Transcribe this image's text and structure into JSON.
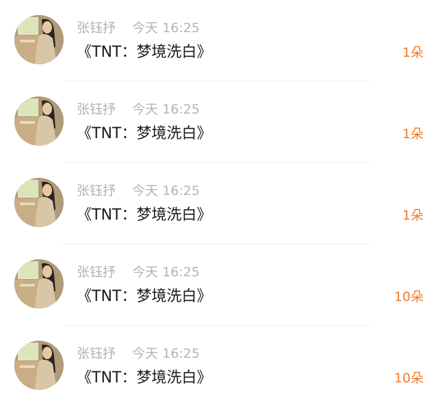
{
  "colors": {
    "name_gray": "#b3b3b3",
    "title_black": "#1a1a1a",
    "count_orange": "#f07a2b"
  },
  "records": [
    {
      "avatar": "user-avatar-photo",
      "name": "张钰抒",
      "time": "今天 16:25",
      "title": "《TNT：梦境洗白》",
      "count": "1朵"
    },
    {
      "avatar": "user-avatar-photo",
      "name": "张钰抒",
      "time": "今天 16:25",
      "title": "《TNT：梦境洗白》",
      "count": "1朵"
    },
    {
      "avatar": "user-avatar-photo",
      "name": "张钰抒",
      "time": "今天 16:25",
      "title": "《TNT：梦境洗白》",
      "count": "1朵"
    },
    {
      "avatar": "user-avatar-photo",
      "name": "张钰抒",
      "time": "今天 16:25",
      "title": "《TNT：梦境洗白》",
      "count": "10朵"
    },
    {
      "avatar": "user-avatar-photo",
      "name": "张钰抒",
      "time": "今天 16:25",
      "title": "《TNT：梦境洗白》",
      "count": "10朵"
    }
  ]
}
